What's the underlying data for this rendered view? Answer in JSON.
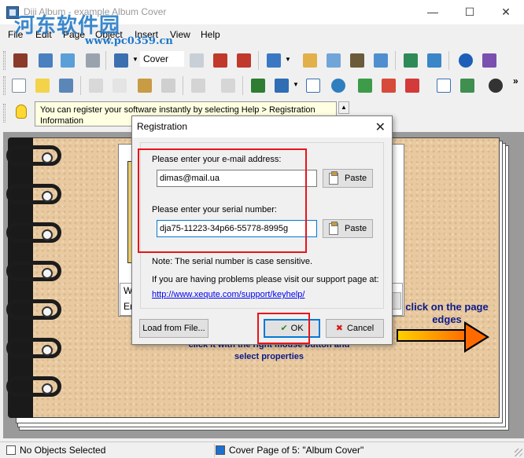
{
  "window": {
    "title": "Diji Album - example Album Cover",
    "controls": {
      "minimize": "—",
      "maximize": "☐",
      "close": "✕"
    }
  },
  "watermark": {
    "text": "河东软件园",
    "url": "www.pc0359.cn"
  },
  "menu": [
    "File",
    "Edit",
    "Page",
    "Object",
    "Insert",
    "View",
    "Help"
  ],
  "toolbar": {
    "cover_combo_value": "Cover",
    "overflow": "»"
  },
  "tip": {
    "text": "You can register your software instantly by selecting Help > Registration Information",
    "scroll_up": "▲"
  },
  "page": {
    "hint_right": "click on the page edges",
    "hint_bottom": "click it with the right mouse button and select properties",
    "partial_w": "W",
    "partial_er": "Er"
  },
  "dialog": {
    "title": "Registration",
    "close": "✕",
    "email_label": "Please enter your e-mail address:",
    "email_value": "dimas@mail.ua",
    "serial_label": "Please enter your serial number:",
    "serial_value": "dja75-11223-34p66-55778-8995g",
    "paste_label": "Paste",
    "note": "Note: The serial number is case sensitive.",
    "problems_text": "If you are having problems please visit our support page at:",
    "support_link": "http://www.xequte.com/support/keyhelp/",
    "load_button": "Load from File...",
    "ok_button": "OK",
    "cancel_button": "Cancel",
    "ok_icon": "✔",
    "cancel_icon": "✖"
  },
  "status": {
    "objects": "No Objects Selected",
    "page": "Cover Page of 5: \"Album Cover\""
  },
  "colors": {
    "highlight": "#e8141a",
    "accent": "#0078d7",
    "page_bg": "#e8c9a0",
    "hint_text": "#0a1a8a"
  }
}
